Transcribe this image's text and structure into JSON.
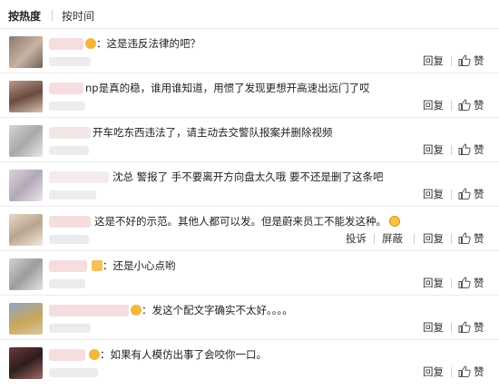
{
  "tabs": {
    "hot": "按热度",
    "time": "按时间"
  },
  "actions": {
    "reply": "回复",
    "like": "赞",
    "report": "投诉",
    "block": "屏蔽"
  },
  "icons": {
    "like": "thumbs-up-icon",
    "emoji": "emoji-icon"
  },
  "colors": {
    "text": "#222222",
    "action": "#333333",
    "divider": "#ededed"
  },
  "comments": [
    {
      "text": "：这是违反法律的吧？"
    },
    {
      "text": "np是真的稳，谁用谁知道，用惯了发现更想开高速出远门了哎"
    },
    {
      "text": "开车吃东西违法了，请主动去交警队报案并删除视频"
    },
    {
      "text": "沈总 警报了 手不要离开方向盘太久哦 要不还是删了这条吧"
    },
    {
      "text": "这是不好的示范。其他人都可以发。但是蔚来员工不能发这种。"
    },
    {
      "text": "：还是小心点哟"
    },
    {
      "text": "：发这个配文字确实不太好。。。。"
    },
    {
      "text": "：如果有人模仿出事了会咬你一口。"
    }
  ]
}
